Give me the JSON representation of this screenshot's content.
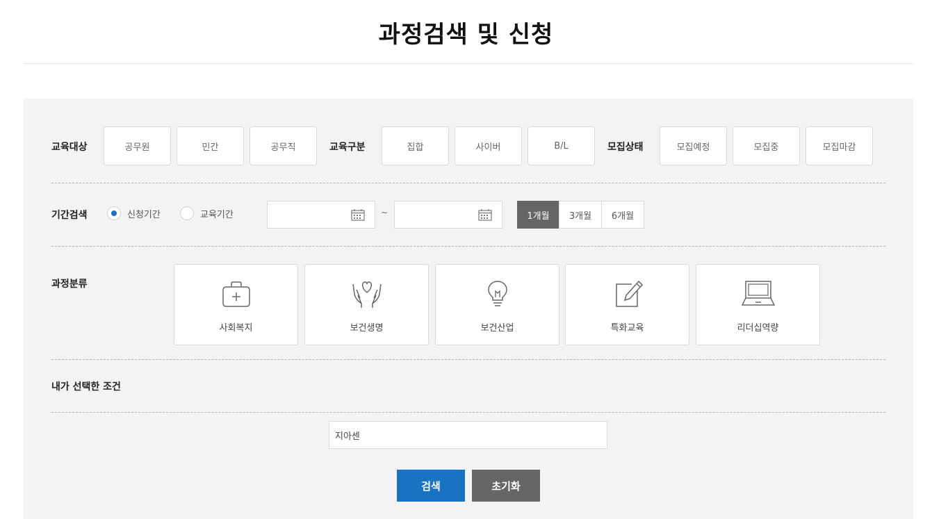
{
  "page": {
    "title": "과정검색 및 신청"
  },
  "filters": {
    "target": {
      "label": "교육대상",
      "options": [
        "공무원",
        "민간",
        "공무직"
      ]
    },
    "type": {
      "label": "교육구분",
      "options": [
        "집합",
        "사이버",
        "B/L"
      ]
    },
    "status": {
      "label": "모집상태",
      "options": [
        "모집예정",
        "모집중",
        "모집마감"
      ]
    }
  },
  "period": {
    "label": "기간검색",
    "radios": [
      {
        "label": "신청기간",
        "checked": true
      },
      {
        "label": "교육기간",
        "checked": false
      }
    ],
    "start_date": "",
    "end_date": "",
    "separator": "~",
    "quick": [
      {
        "label": "1개월",
        "active": true
      },
      {
        "label": "3개월",
        "active": false
      },
      {
        "label": "6개월",
        "active": false
      }
    ]
  },
  "category": {
    "label": "과정분류",
    "items": [
      {
        "label": "사회복지",
        "icon": "medical-kit-icon"
      },
      {
        "label": "보건생명",
        "icon": "hands-heart-icon"
      },
      {
        "label": "보건산업",
        "icon": "lightbulb-icon"
      },
      {
        "label": "특화교육",
        "icon": "pencil-edit-icon"
      },
      {
        "label": "리더십역량",
        "icon": "laptop-icon"
      }
    ]
  },
  "selected": {
    "label": "내가 선택한 조건"
  },
  "search": {
    "value": "지아센",
    "placeholder": ""
  },
  "actions": {
    "search_label": "검색",
    "reset_label": "초기화"
  },
  "colors": {
    "primary": "#1a73c2",
    "reset": "#666666",
    "panel_bg": "#f2f3f5"
  }
}
